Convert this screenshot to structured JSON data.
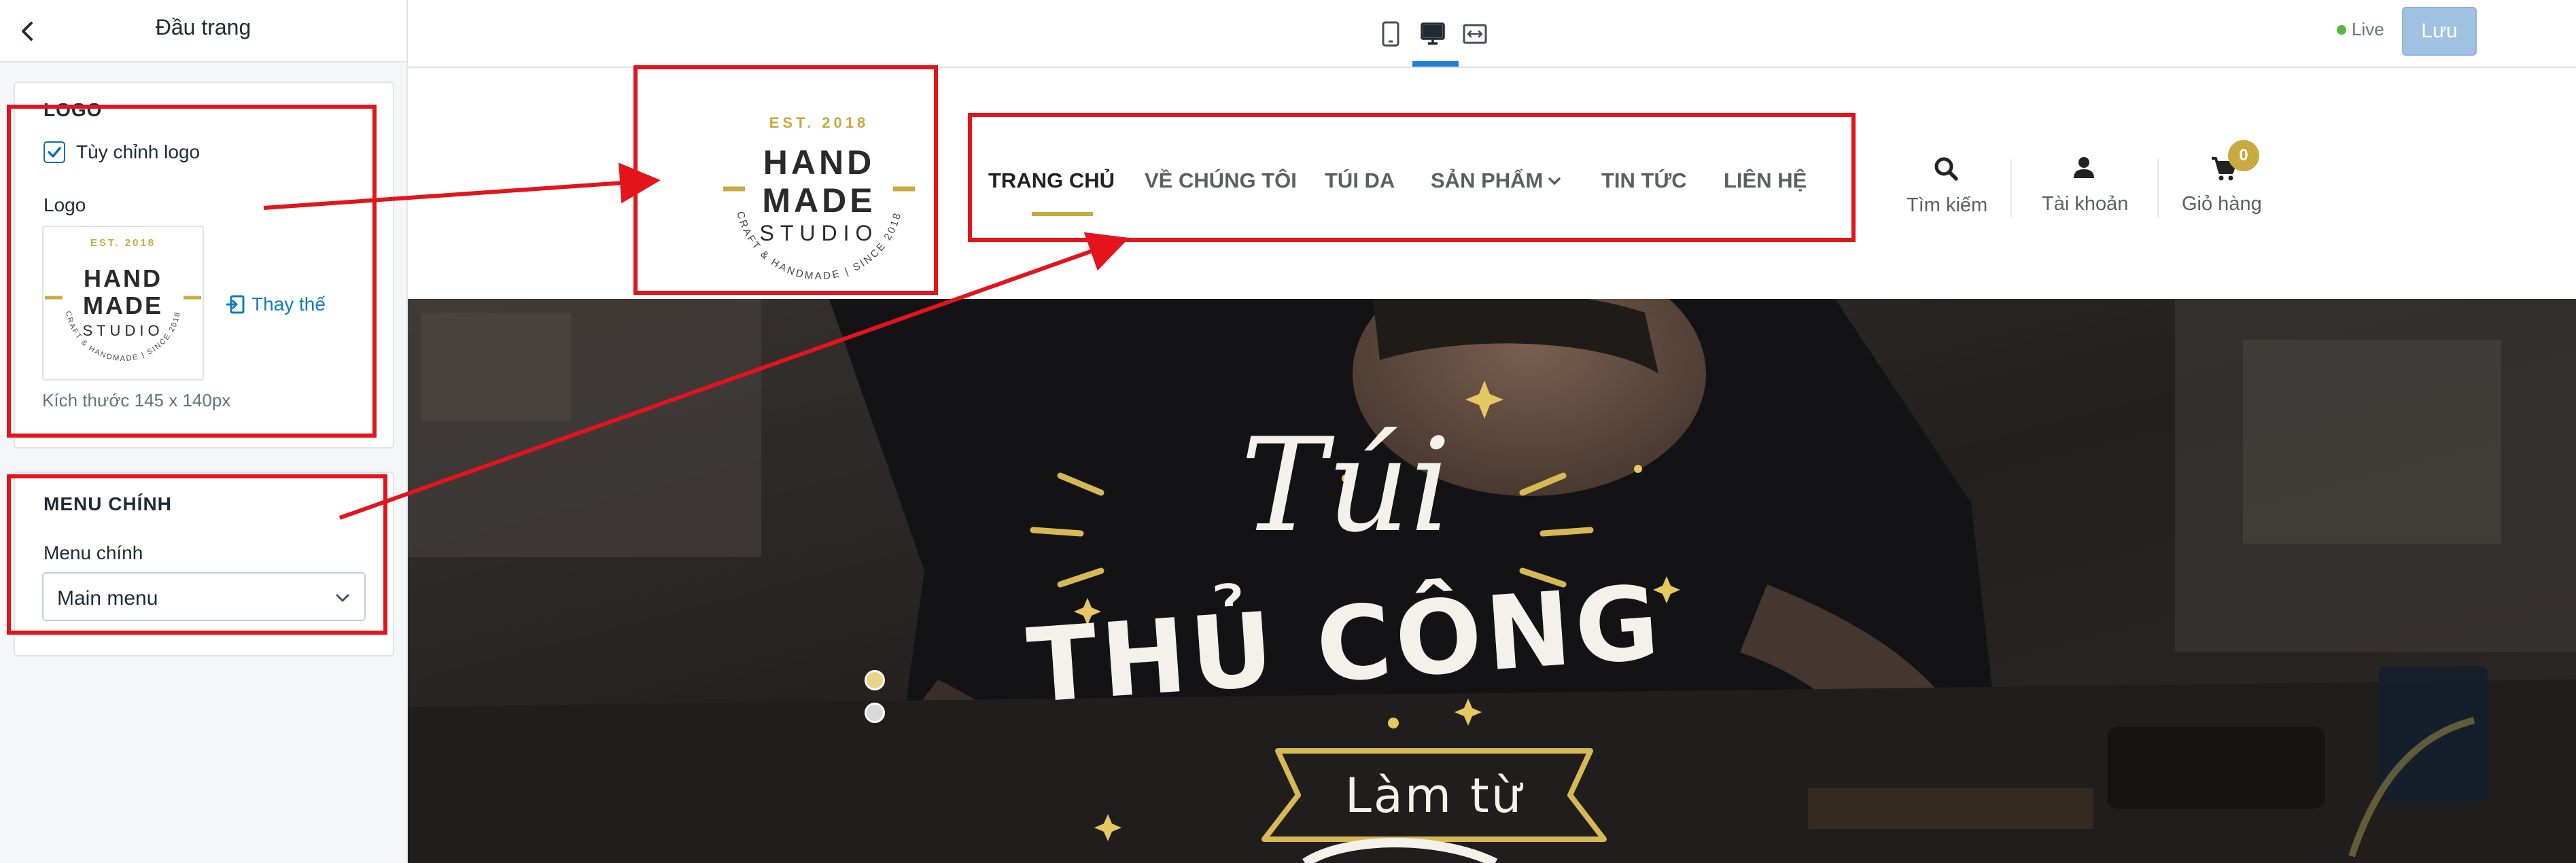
{
  "sidebar": {
    "title": "Đầu trang",
    "logo_section": {
      "title": "LOGO",
      "custom_logo_label": "Tùy chỉnh logo",
      "custom_logo_checked": true,
      "logo_label": "Logo",
      "replace_label": "Thay thế",
      "size_hint": "Kích thước 145 x 140px"
    },
    "menu_section": {
      "title": "MENU CHÍNH",
      "field_label": "Menu chính",
      "selected": "Main menu"
    }
  },
  "topbar": {
    "devices": [
      "mobile-icon",
      "desktop-icon",
      "fullwidth-icon"
    ],
    "active_device": "desktop",
    "live_label": "Live",
    "save_label": "Lưu"
  },
  "store": {
    "logo": {
      "est": "EST. 2018",
      "line1": "HAND",
      "line2": "MADE",
      "line3": "STUDIO",
      "ring": "CRAFT & HANDMADE | SINCE 2018"
    },
    "nav": [
      "TRANG CHỦ",
      "VỀ CHÚNG TÔI",
      "TÚI DA",
      "SẢN PHẨM",
      "TIN TỨC",
      "LIÊN HỆ"
    ],
    "search_label": "Tìm kiếm",
    "account_label": "Tài khoản",
    "cart_label": "Giỏ hàng",
    "cart_count": "0"
  },
  "hero": {
    "line1": "Túi",
    "line2": "THỦ CÔNG",
    "banner": "Làm từ",
    "slides_total": 2,
    "active_slide": 1
  },
  "colors": {
    "accent_gold": "#c9a940",
    "annotation_red": "#e3141b",
    "link_blue": "#0c7dbd"
  }
}
